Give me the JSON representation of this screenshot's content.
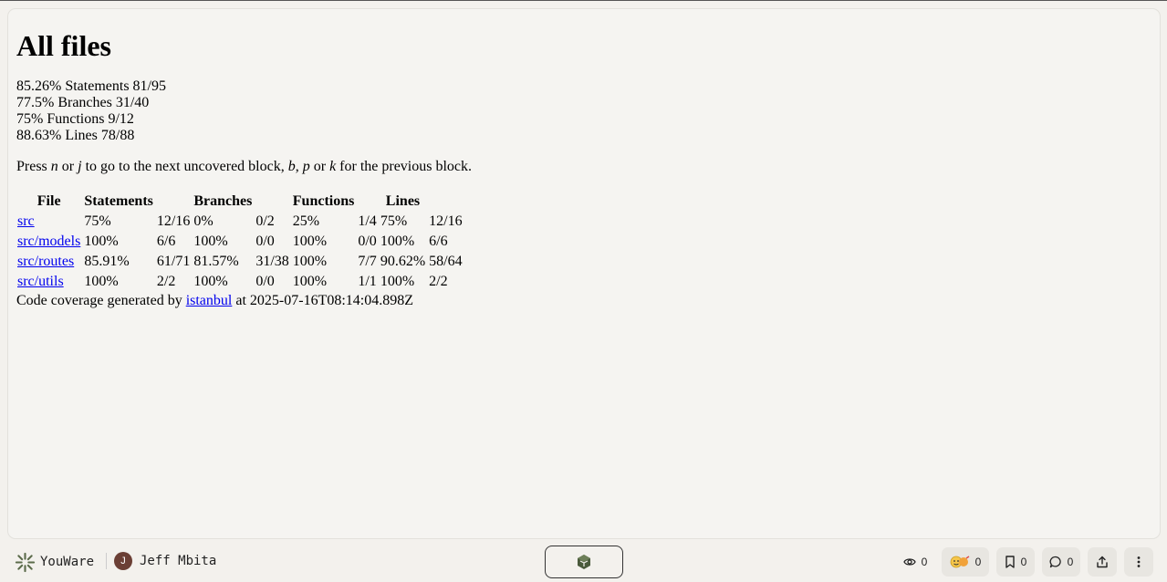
{
  "report": {
    "title": "All files",
    "summary": [
      {
        "pct": "85.26%",
        "label": "Statements",
        "fraction": "81/95"
      },
      {
        "pct": "77.5%",
        "label": "Branches",
        "fraction": "31/40"
      },
      {
        "pct": "75%",
        "label": "Functions",
        "fraction": "9/12"
      },
      {
        "pct": "88.63%",
        "label": "Lines",
        "fraction": "78/88"
      }
    ],
    "hint": {
      "press": "Press",
      "n": "n",
      "or1": "or",
      "j": "j",
      "mid": "to go to the next uncovered block,",
      "b": "b",
      "comma": ",",
      "p": "p",
      "or2": "or",
      "k": "k",
      "end": "for the previous block."
    },
    "table": {
      "headers": [
        "File",
        "Statements",
        "",
        "Branches",
        "",
        "Functions",
        "",
        "Lines",
        ""
      ],
      "rows": [
        [
          "src",
          "75%",
          "12/16",
          "0%",
          "0/2",
          "25%",
          "1/4",
          "75%",
          "12/16"
        ],
        [
          "src/models",
          "100%",
          "6/6",
          "100%",
          "0/0",
          "100%",
          "0/0",
          "100%",
          "6/6"
        ],
        [
          "src/routes",
          "85.91%",
          "61/71",
          "81.57%",
          "31/38",
          "100%",
          "7/7",
          "90.62%",
          "58/64"
        ],
        [
          "src/utils",
          "100%",
          "2/2",
          "100%",
          "0/0",
          "100%",
          "1/1",
          "100%",
          "2/2"
        ]
      ]
    },
    "footer": {
      "prefix": "Code coverage generated by",
      "link": "istanbul",
      "suffix": "at 2025-07-16T08:14:04.898Z"
    }
  },
  "bottom_bar": {
    "brand": "YouWare",
    "brand_icon": "youware-logo-icon",
    "user_initial": "J",
    "user_name": "Jeff Mbita",
    "center_icon": "cube-icon",
    "views": "0",
    "reactions": "0",
    "bookmarks": "0",
    "comments": "0",
    "colors": {
      "accent": "#5b6b4a",
      "avatar": "#6b3f35"
    }
  }
}
